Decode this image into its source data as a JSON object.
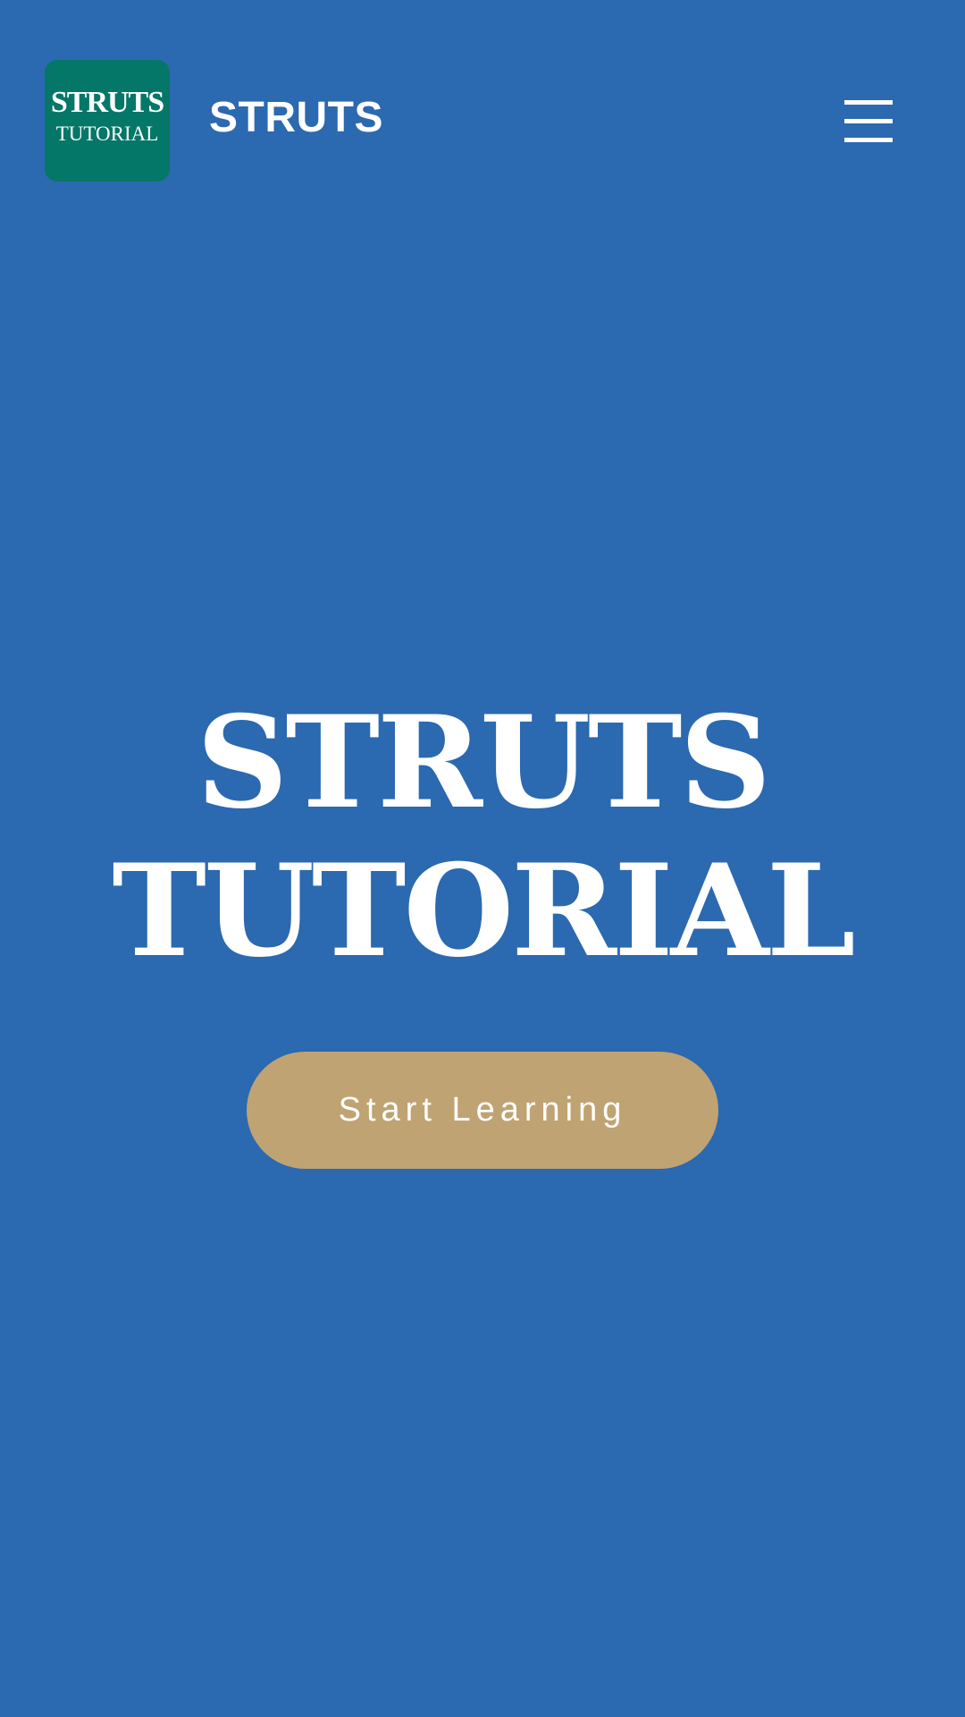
{
  "header": {
    "logo": {
      "line1": "STRUTS",
      "line2": "TUTORIAL",
      "background": "#047768"
    },
    "brand": "STRUTS",
    "menu_icon": "hamburger-menu-icon"
  },
  "hero": {
    "title_line1": "STRUTS",
    "title_line2": "TUTORIAL",
    "cta_label": "Start Learning"
  },
  "colors": {
    "background": "#2b69b0",
    "logo": "#047768",
    "cta": "#c0a372",
    "text": "#ffffff"
  }
}
